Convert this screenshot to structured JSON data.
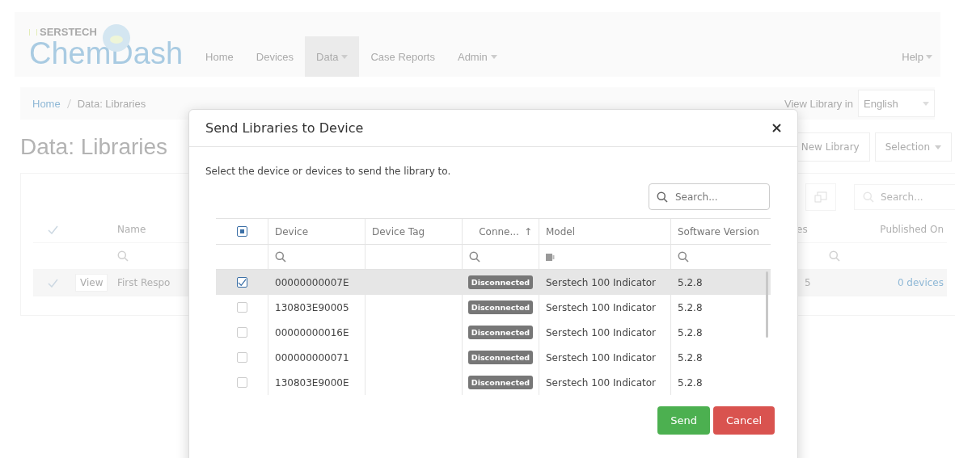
{
  "navbar": {
    "brand_top": "SERSTECH",
    "brand": "ChemDash",
    "items": [
      {
        "label": "Home",
        "selected": false,
        "dropdown": false
      },
      {
        "label": "Devices",
        "selected": false,
        "dropdown": false
      },
      {
        "label": "Data",
        "selected": true,
        "dropdown": true
      },
      {
        "label": "Case Reports",
        "selected": false,
        "dropdown": false
      },
      {
        "label": "Admin",
        "selected": false,
        "dropdown": true
      }
    ],
    "help": {
      "label": "Help",
      "dropdown": true
    }
  },
  "breadcrumb": [
    "Home",
    "Data: Libraries"
  ],
  "language": {
    "label": "View Library in",
    "value": "English"
  },
  "page_title": "Data: Libraries",
  "actions": [
    {
      "label": "New Library",
      "dropdown": false
    },
    {
      "label": "Selection",
      "dropdown": true
    }
  ],
  "library_table": {
    "search_placeholder": "Search...",
    "columns": [
      "Name",
      "es",
      "Published On"
    ],
    "rows": [
      {
        "checked": true,
        "view": "View",
        "name": "First Respo",
        "count": "5",
        "published": "0 devices"
      }
    ]
  },
  "dialog": {
    "title": "Send Libraries to Device",
    "instruction": "Select the device or devices to send the library to.",
    "search_placeholder": "Search...",
    "select_all": {
      "indeterminate": true
    },
    "columns": [
      {
        "label": "Device"
      },
      {
        "label": "Device Tag"
      },
      {
        "label": "Conne...",
        "sort": "↑"
      },
      {
        "label": "Model"
      },
      {
        "label": "Software Version"
      }
    ],
    "filters": [
      {
        "kind": "search"
      },
      {
        "kind": "blank"
      },
      {
        "kind": "search"
      },
      {
        "kind": "text"
      },
      {
        "kind": "search"
      }
    ],
    "rows": [
      {
        "checked": true,
        "selected": true,
        "device": "00000000007E",
        "status": "Disconnected",
        "model": "Serstech 100 Indicator",
        "version": "5.2.8"
      },
      {
        "checked": false,
        "selected": false,
        "device": "130803E90005",
        "status": "Disconnected",
        "model": "Serstech 100 Indicator",
        "version": "5.2.8"
      },
      {
        "checked": false,
        "selected": false,
        "device": "00000000016E",
        "status": "Disconnected",
        "model": "Serstech 100 Indicator",
        "version": "5.2.8"
      },
      {
        "checked": false,
        "selected": false,
        "device": "000000000071",
        "status": "Disconnected",
        "model": "Serstech 100 Indicator",
        "version": "5.2.8"
      },
      {
        "checked": false,
        "selected": false,
        "device": "130803E9000E",
        "status": "Disconnected",
        "model": "Serstech 100 Indicator",
        "version": "5.2.8"
      }
    ],
    "buttons": [
      {
        "label": "Send",
        "kind": "primary"
      },
      {
        "label": "Cancel",
        "kind": "danger"
      }
    ]
  }
}
